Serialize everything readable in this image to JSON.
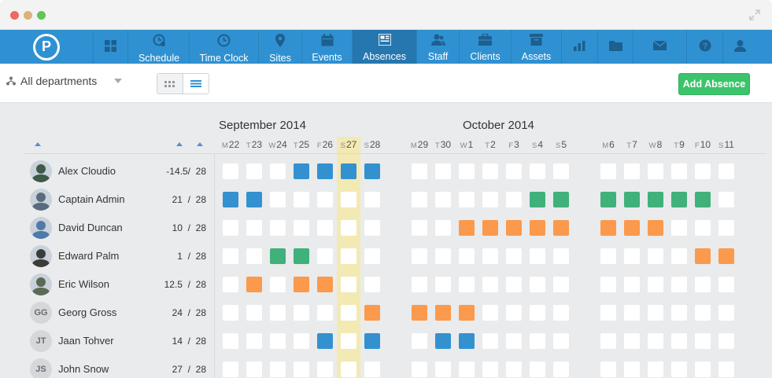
{
  "nav": {
    "items": [
      {
        "key": "dashboard",
        "label": "",
        "icon": "grid-icon"
      },
      {
        "key": "schedule",
        "label": "Schedule",
        "icon": "schedule-icon"
      },
      {
        "key": "timeclock",
        "label": "Time Clock",
        "icon": "clock-icon"
      },
      {
        "key": "sites",
        "label": "Sites",
        "icon": "pin-icon"
      },
      {
        "key": "events",
        "label": "Events",
        "icon": "calendar-icon"
      },
      {
        "key": "absences",
        "label": "Absences",
        "icon": "absences-icon"
      },
      {
        "key": "staff",
        "label": "Staff",
        "icon": "staff-icon"
      },
      {
        "key": "clients",
        "label": "Clients",
        "icon": "briefcase-icon"
      },
      {
        "key": "assets",
        "label": "Assets",
        "icon": "archive-icon"
      },
      {
        "key": "reports",
        "label": "",
        "icon": "bar-chart-icon"
      },
      {
        "key": "files",
        "label": "",
        "icon": "folder-icon"
      },
      {
        "key": "messages",
        "label": "",
        "icon": "mail-icon"
      },
      {
        "key": "help",
        "label": "",
        "icon": "help-icon"
      },
      {
        "key": "profile",
        "label": "",
        "icon": "user-icon"
      }
    ],
    "active": "absences",
    "logo_letter": "P"
  },
  "toolbar": {
    "department": "All departments",
    "add_absence_label": "Add Absence"
  },
  "calendar": {
    "months": [
      "September 2014",
      "October 2014"
    ],
    "days": [
      {
        "l": "M",
        "n": "22"
      },
      {
        "l": "T",
        "n": "23"
      },
      {
        "l": "W",
        "n": "24"
      },
      {
        "l": "T",
        "n": "25"
      },
      {
        "l": "F",
        "n": "26"
      },
      {
        "l": "S",
        "n": "27"
      },
      {
        "l": "S",
        "n": "28"
      },
      {
        "l": "M",
        "n": "29"
      },
      {
        "l": "T",
        "n": "30"
      },
      {
        "l": "W",
        "n": "1"
      },
      {
        "l": "T",
        "n": "2"
      },
      {
        "l": "F",
        "n": "3"
      },
      {
        "l": "S",
        "n": "4"
      },
      {
        "l": "S",
        "n": "5"
      },
      {
        "l": "M",
        "n": "6"
      },
      {
        "l": "T",
        "n": "7"
      },
      {
        "l": "W",
        "n": "8"
      },
      {
        "l": "T",
        "n": "9"
      },
      {
        "l": "F",
        "n": "10"
      },
      {
        "l": "S",
        "n": "11"
      }
    ],
    "today": "27",
    "colors": {
      "blue": "#3391d0",
      "green": "#40b17a",
      "orange": "#fb9a4c",
      "empty": "#ffffff"
    },
    "rows": [
      {
        "name": "Alex Cloudio",
        "used": "-14.5/",
        "total": "28",
        "avatar": "photo",
        "initials": "",
        "cells": [
          "",
          "",
          "",
          "blue",
          "blue",
          "blue",
          "blue",
          "",
          "",
          "",
          "",
          "",
          "",
          "",
          "",
          "",
          "",
          "",
          "",
          ""
        ]
      },
      {
        "name": "Captain Admin",
        "used": "21",
        "total": "28",
        "avatar": "photo",
        "initials": "",
        "cells": [
          "blue",
          "blue",
          "",
          "",
          "",
          "",
          "",
          "",
          "",
          "",
          "",
          "",
          "green",
          "green",
          "green",
          "green",
          "green",
          "green",
          "green",
          ""
        ]
      },
      {
        "name": "David Duncan",
        "used": "10",
        "total": "28",
        "avatar": "photo",
        "initials": "",
        "cells": [
          "",
          "",
          "",
          "",
          "",
          "",
          "",
          "",
          "",
          "orange",
          "orange",
          "orange",
          "orange",
          "orange",
          "orange",
          "orange",
          "orange",
          "",
          "",
          ""
        ]
      },
      {
        "name": "Edward Palm",
        "used": "1",
        "total": "28",
        "avatar": "photo",
        "initials": "",
        "cells": [
          "",
          "",
          "green",
          "green",
          "",
          "",
          "",
          "",
          "",
          "",
          "",
          "",
          "",
          "",
          "",
          "",
          "",
          "",
          "orange",
          "orange"
        ]
      },
      {
        "name": "Eric Wilson",
        "used": "12.5",
        "total": "28",
        "avatar": "photo",
        "initials": "",
        "cells": [
          "",
          "orange",
          "",
          "orange",
          "orange",
          "",
          "",
          "",
          "",
          "",
          "",
          "",
          "",
          "",
          "",
          "",
          "",
          "",
          "",
          ""
        ]
      },
      {
        "name": "Georg Gross",
        "used": "24",
        "total": "28",
        "avatar": "initials",
        "initials": "GG",
        "cells": [
          "",
          "",
          "",
          "",
          "",
          "",
          "orange",
          "orange",
          "orange",
          "orange",
          "",
          "",
          "",
          "",
          "",
          "",
          "",
          "",
          "",
          ""
        ]
      },
      {
        "name": "Jaan Tohver",
        "used": "14",
        "total": "28",
        "avatar": "initials",
        "initials": "JT",
        "cells": [
          "",
          "",
          "",
          "",
          "blue",
          "",
          "blue",
          "",
          "blue",
          "blue",
          "",
          "",
          "",
          "",
          "",
          "",
          "",
          "",
          "",
          ""
        ]
      },
      {
        "name": "John Snow",
        "used": "27",
        "total": "28",
        "avatar": "initials",
        "initials": "JS",
        "cells": [
          "",
          "",
          "",
          "",
          "",
          "",
          "",
          "",
          "",
          "",
          "",
          "",
          "",
          "",
          "",
          "",
          "",
          "",
          "",
          ""
        ]
      }
    ]
  }
}
